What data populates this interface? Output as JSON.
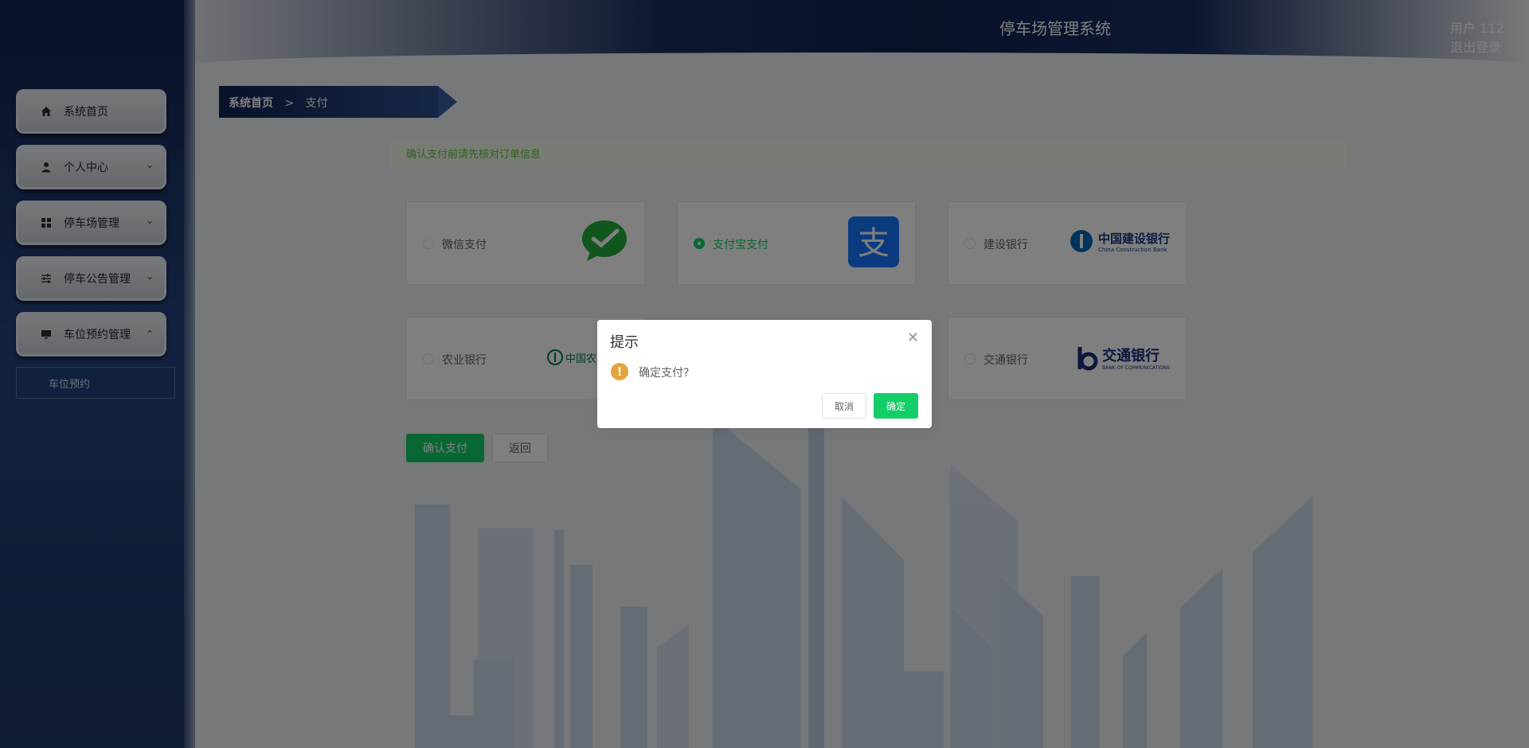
{
  "header": {
    "site_title": "停车场管理系统",
    "user_label": "用户 112",
    "logout_label": "退出登录"
  },
  "sidebar": {
    "items": [
      {
        "label": "系统首页",
        "icon": "home-icon"
      },
      {
        "label": "个人中心",
        "icon": "user-icon"
      },
      {
        "label": "停车场管理",
        "icon": "grid-icon"
      },
      {
        "label": "停车公告管理",
        "icon": "sliders-icon"
      },
      {
        "label": "车位预约管理",
        "icon": "monitor-icon"
      }
    ],
    "submenu_label": "车位预约"
  },
  "breadcrumb": {
    "home": "系统首页",
    "separator": ">",
    "current": "支付"
  },
  "main": {
    "alert_text": "确认支付前请先核对订单信息",
    "payment_options": [
      {
        "label": "微信支付",
        "selected": false,
        "logo": "wechat-pay-logo"
      },
      {
        "label": "支付宝支付",
        "selected": true,
        "logo": "alipay-logo"
      },
      {
        "label": "建设银行",
        "selected": false,
        "logo": "ccb-logo"
      },
      {
        "label": "农业银行",
        "selected": false,
        "logo": "abc-logo"
      },
      {
        "label": "交通银行",
        "selected": false,
        "logo": "bocom-logo"
      }
    ],
    "confirm_button": "确认支付",
    "back_button": "返回"
  },
  "dialog": {
    "title": "提示",
    "message": "确定支付?",
    "cancel": "取消",
    "ok": "确定",
    "close_icon": "close-icon",
    "warning_icon": "warning-icon"
  },
  "colors": {
    "primary": "#13ce66",
    "sidebar": "#0f2452",
    "warning": "#e6a23c"
  },
  "logos": {
    "ccb_cn": "中国建设银行",
    "ccb_en": "China Construction Bank",
    "abc_cn": "中国农",
    "bocom_cn": "交通银行",
    "bocom_en": "BANK OF COMMUNICATIONS"
  }
}
